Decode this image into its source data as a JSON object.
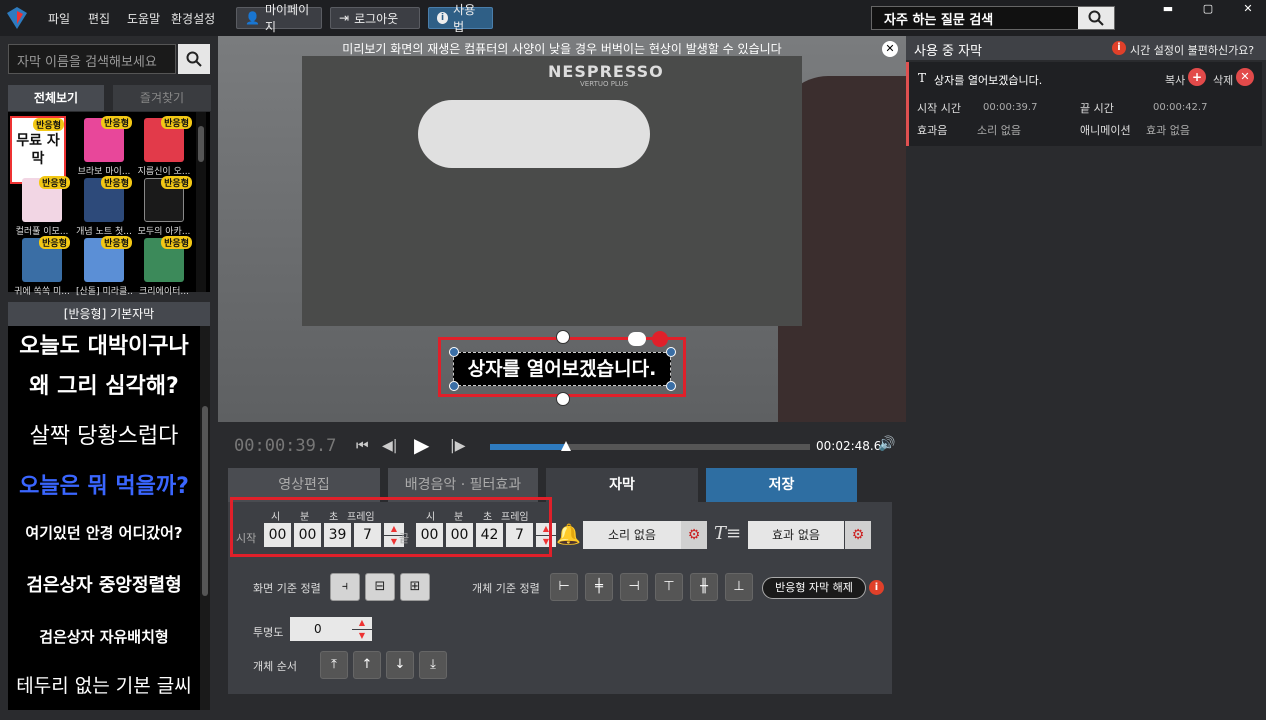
{
  "menu": {
    "file": "파일",
    "edit": "편집",
    "help": "도움말",
    "settings": "환경설정"
  },
  "topbuttons": {
    "mypage": "마이페이지",
    "logout": "로그아웃",
    "usage": "사용법"
  },
  "faq": {
    "placeholder": "자주 하는 질문 검색"
  },
  "left": {
    "search_placeholder": "자막 이름을 검색해보세요",
    "tab_all": "전체보기",
    "tab_fav": "즐겨찾기",
    "thumbs": [
      {
        "tag": "반응형",
        "label": "",
        "text": "무료 자막"
      },
      {
        "tag": "반응형",
        "label": "브라보 마이..."
      },
      {
        "tag": "반응형",
        "label": "지름신이 오..."
      },
      {
        "tag": "반응형",
        "label": "컬러풀 이모..."
      },
      {
        "tag": "반응형",
        "label": "개념 노트 첫..."
      },
      {
        "tag": "반응형",
        "label": "모두의 아카..."
      },
      {
        "tag": "반응형",
        "label": "귀에 쏙쏙 미..."
      },
      {
        "tag": "반응형",
        "label": "[산돌] 미라클..."
      },
      {
        "tag": "반응형",
        "label": "크리에이터..."
      }
    ],
    "section_title": "[반응형] 기본자막",
    "styles": [
      "오늘도 대박이구나",
      "왜 그리 심각해?",
      "살짝 당황스럽다",
      "오늘은 뭐 먹을까?",
      "여기있던 안경 어디갔어?",
      "검은상자 중앙정렬형",
      "검은상자 자유배치형",
      "테두리 없는 기본 글씨"
    ]
  },
  "preview": {
    "notice": "미리보기 화면의 재생은 컴퓨터의 사양이 낮을 경우 버벅이는 현상이 발생할 수 있습니다",
    "brand": "NESPRESSO",
    "subbrand": "VERTUO PLUS",
    "subtitle": "상자를 열어보겠습니다."
  },
  "player": {
    "current": "00:00:39.7",
    "end": "00:02:48.6",
    "progress": 0.236
  },
  "tabs": {
    "video": "영상편집",
    "music": "배경음악 · 필터효과",
    "subtitle": "자막",
    "save": "저장"
  },
  "timing": {
    "labels": {
      "h": "시",
      "m": "분",
      "s": "초",
      "f": "프레임",
      "start": "시작",
      "end": "끝"
    },
    "start": {
      "h": "00",
      "m": "00",
      "s": "39",
      "f": "7"
    },
    "end": {
      "h": "00",
      "m": "00",
      "s": "42",
      "f": "7"
    },
    "sound": "소리 없음",
    "effect": "효과 없음"
  },
  "align": {
    "screen_label": "화면 기준 정렬",
    "object_label": "개체 기준 정렬",
    "release": "반응형 자막 해제",
    "opacity_label": "투명도",
    "opacity": "0",
    "order_label": "개체 순서"
  },
  "right": {
    "title": "사용 중 자막",
    "help": "시간 설정이 불편하신가요?",
    "item_text": "상자를 열어보겠습니다.",
    "copy": "복사",
    "delete": "삭제",
    "start_k": "시작 시간",
    "start_v": "00:00:39.7",
    "end_k": "끝 시간",
    "end_v": "00:00:42.7",
    "sound_k": "효과음",
    "sound_v": "소리 없음",
    "anim_k": "애니메이션",
    "anim_v": "효과 없음"
  },
  "colors": {
    "accent": "#2e7bbf",
    "danger": "#e0202a",
    "tag": "#f3c815"
  }
}
